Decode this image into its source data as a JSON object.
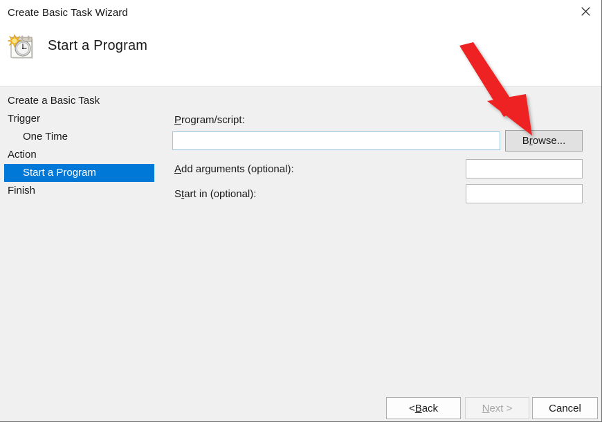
{
  "window": {
    "title": "Create Basic Task Wizard",
    "close_icon": "close-icon"
  },
  "header": {
    "title": "Start a Program",
    "icon": "task-scheduler-icon"
  },
  "sidebar": {
    "items": [
      {
        "label": "Create a Basic Task",
        "indent": false,
        "selected": false
      },
      {
        "label": "Trigger",
        "indent": false,
        "selected": false
      },
      {
        "label": "One Time",
        "indent": true,
        "selected": false
      },
      {
        "label": "Action",
        "indent": false,
        "selected": false
      },
      {
        "label": "Start a Program",
        "indent": true,
        "selected": true
      },
      {
        "label": "Finish",
        "indent": false,
        "selected": false
      }
    ],
    "selected_color": "#0078d7"
  },
  "form": {
    "program_script": {
      "label_before": "",
      "label_mnemonic": "P",
      "label_after": "rogram/script:",
      "value": "",
      "placeholder": ""
    },
    "browse_button": {
      "label_before": "B",
      "label_mnemonic": "r",
      "label_after": "owse..."
    },
    "add_arguments": {
      "label_before": "",
      "label_mnemonic": "A",
      "label_after": "dd arguments (optional):",
      "value": "",
      "placeholder": ""
    },
    "start_in": {
      "label_before": "S",
      "label_mnemonic": "t",
      "label_after": "art in (optional):",
      "value": "",
      "placeholder": ""
    }
  },
  "footer": {
    "back_button": {
      "label_before": "< ",
      "label_mnemonic": "B",
      "label_after": "ack",
      "enabled": true
    },
    "next_button": {
      "label_before": "",
      "label_mnemonic": "N",
      "label_after": "ext >",
      "enabled": false
    },
    "cancel_button": {
      "label_before": "Cancel",
      "label_mnemonic": "",
      "label_after": "",
      "enabled": true
    }
  },
  "annotation": {
    "type": "arrow",
    "color": "#ee2222",
    "points_to": "browse-button"
  }
}
